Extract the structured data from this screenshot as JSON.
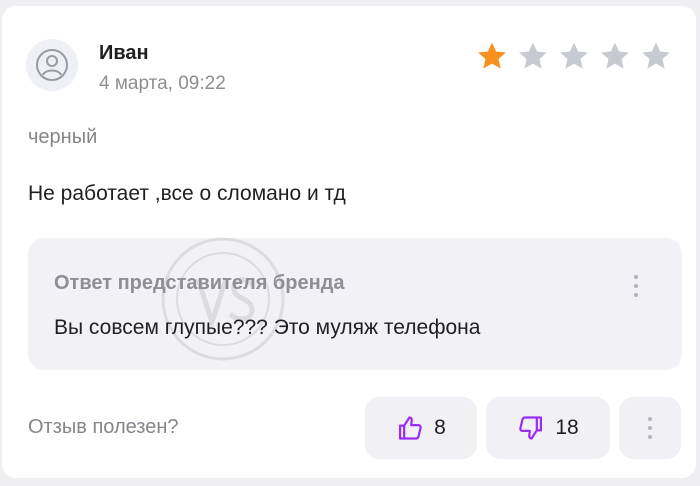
{
  "review": {
    "author": "Иван",
    "date": "4 марта, 09:22",
    "rating": 1,
    "rating_max": 5,
    "variant": "черный",
    "text": "Не работает ,все о сломано и тд"
  },
  "brand_reply": {
    "title": "Ответ представителя бренда",
    "text": "Вы совсем глупые??? Это муляж телефона"
  },
  "feedback": {
    "helpful_label": "Отзыв полезен?",
    "likes": "8",
    "dislikes": "18"
  },
  "colors": {
    "star_filled": "#f7911e",
    "star_empty": "#c8cad1",
    "vote_icon": "#9b2cf3"
  },
  "icons": [
    "user-avatar-icon",
    "star-icon",
    "thumbs-up-icon",
    "thumbs-down-icon",
    "more-vertical-icon"
  ]
}
